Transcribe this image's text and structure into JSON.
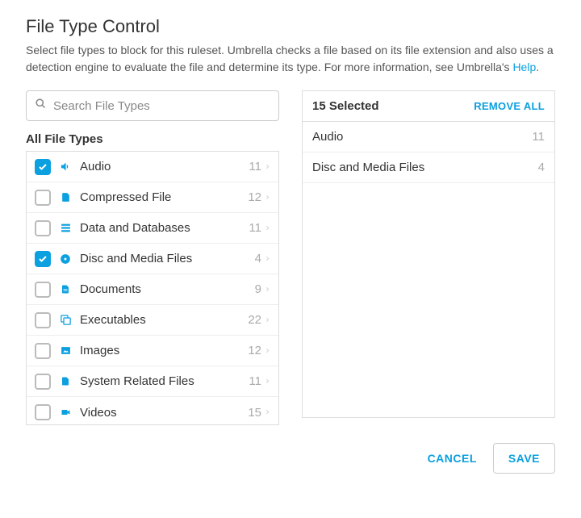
{
  "title": "File Type Control",
  "description_prefix": "Select file types to block for this ruleset. Umbrella checks a file based on its file extension and also uses a detection engine to evaluate the file and determine its type. For more information, see Umbrella's ",
  "help_link": "Help",
  "description_suffix": ".",
  "search": {
    "placeholder": "Search File Types"
  },
  "all_types_title": "All File Types",
  "file_types": [
    {
      "label": "Audio",
      "count": "11",
      "checked": true,
      "icon": "audio"
    },
    {
      "label": "Compressed File",
      "count": "12",
      "checked": false,
      "icon": "compressed"
    },
    {
      "label": "Data and Databases",
      "count": "11",
      "checked": false,
      "icon": "database"
    },
    {
      "label": "Disc and Media Files",
      "count": "4",
      "checked": true,
      "icon": "disc"
    },
    {
      "label": "Documents",
      "count": "9",
      "checked": false,
      "icon": "document"
    },
    {
      "label": "Executables",
      "count": "22",
      "checked": false,
      "icon": "executable"
    },
    {
      "label": "Images",
      "count": "12",
      "checked": false,
      "icon": "image"
    },
    {
      "label": "System Related Files",
      "count": "11",
      "checked": false,
      "icon": "system"
    },
    {
      "label": "Videos",
      "count": "15",
      "checked": false,
      "icon": "video"
    }
  ],
  "selected_header": "15 Selected",
  "remove_all": "REMOVE ALL",
  "selected": [
    {
      "label": "Audio",
      "count": "11"
    },
    {
      "label": "Disc and Media Files",
      "count": "4"
    }
  ],
  "buttons": {
    "cancel": "CANCEL",
    "save": "SAVE"
  }
}
